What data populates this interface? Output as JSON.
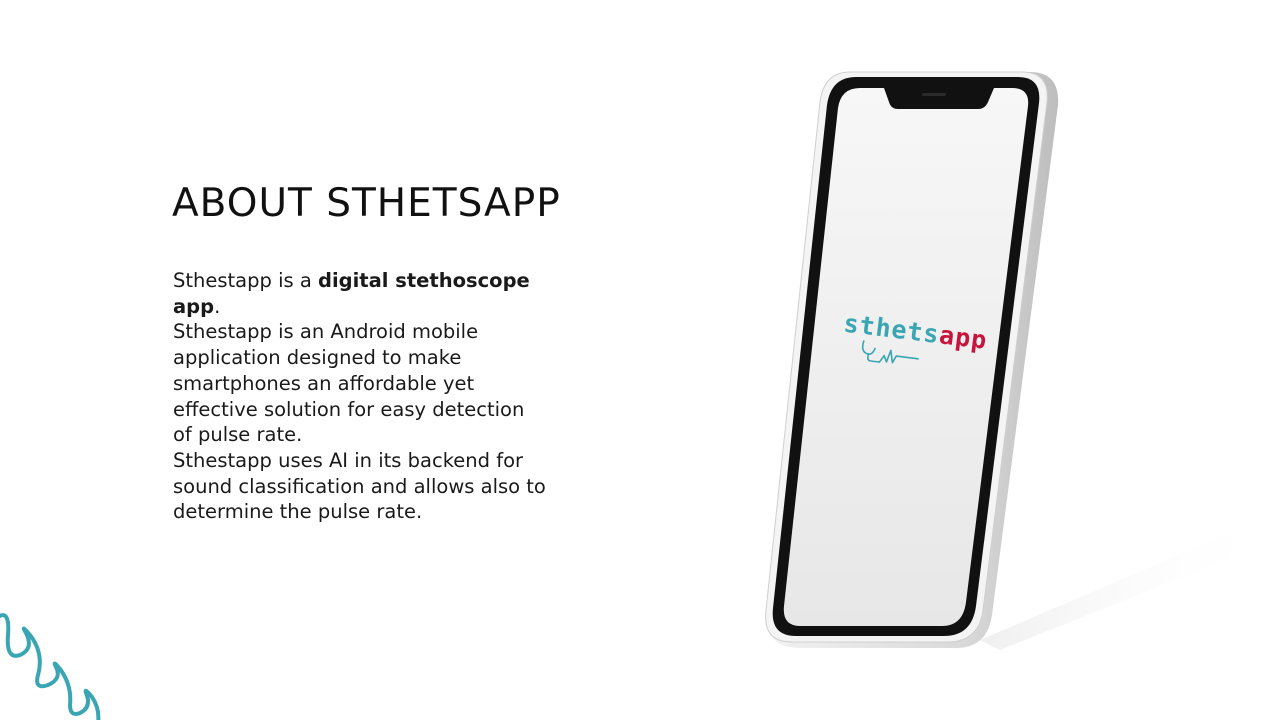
{
  "slide": {
    "title": "ABOUT STHETSAPP",
    "body": {
      "p1_prefix": "Sthestapp is a ",
      "p1_bold": "digital stethoscope app",
      "p1_suffix": ".",
      "p2": "Sthestapp is an Android mobile application designed to make smartphones an affordable yet effective solution for easy detection of pulse rate.",
      "p3": "Sthestapp uses AI in its backend for sound classification and allows also to determine the pulse rate."
    }
  },
  "phone": {
    "logo": {
      "part1": "sthets",
      "part2": "app"
    }
  },
  "colors": {
    "accent_teal": "#3aa6b4",
    "accent_red": "#c8143c",
    "phone_frame": "#111111",
    "screen": "#ececec"
  },
  "icons": {
    "phone": "smartphone-mockup",
    "stethoscope": "stethoscope-wave-icon",
    "decoration": "squiggle-line"
  }
}
